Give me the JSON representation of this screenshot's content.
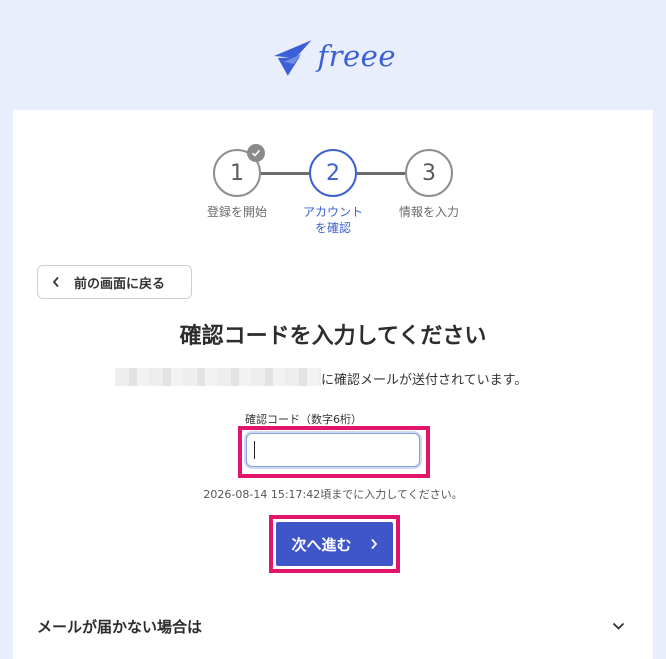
{
  "brand": {
    "name": "freee",
    "color": "#3b5fd6",
    "icon": "swallow-bird-icon"
  },
  "stepper": {
    "steps": [
      {
        "number": "1",
        "label": "登録を開始",
        "state": "completed"
      },
      {
        "number": "2",
        "label": "アカウント\nを確認",
        "state": "active"
      },
      {
        "number": "3",
        "label": "情報を入力",
        "state": "pending"
      }
    ]
  },
  "back_button": {
    "label": "前の画面に戻る",
    "icon": "chevron-left-icon"
  },
  "page_title": "確認コードを入力してください",
  "sent_message": "に確認メールが送付されています。",
  "code_field": {
    "label": "確認コード（数字6桁）",
    "value": ""
  },
  "deadline_text": "2026-08-14 15:17:42頃までに入力してください。",
  "next_button": {
    "label": "次へ進む",
    "icon": "chevron-right-icon",
    "color": "#3f56c9"
  },
  "faq": {
    "label": "メールが届かない場合は",
    "icon": "chevron-down-icon"
  },
  "colors": {
    "accent": "#3f61cf",
    "highlight": "#e0156b",
    "background": "#e8eefb"
  }
}
